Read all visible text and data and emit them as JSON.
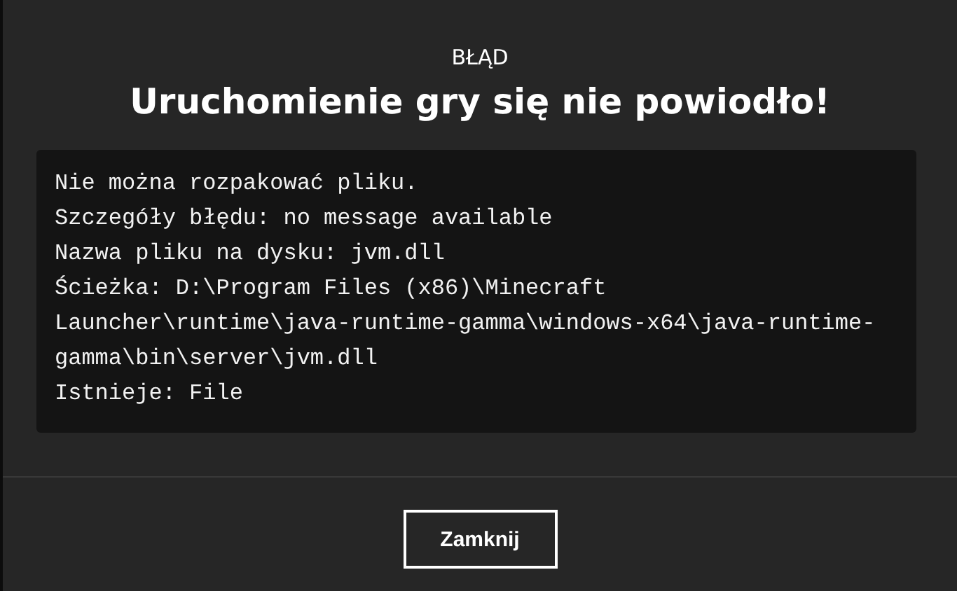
{
  "dialog": {
    "label": "BŁĄD",
    "title": "Uruchomienie gry się nie powiodło!",
    "details": [
      "Nie można rozpakować pliku.",
      "Szczegóły błędu: no message available",
      "Nazwa pliku na dysku: jvm.dll",
      "Ścieżka: D:\\Program Files (x86)\\Minecraft Launcher\\runtime\\java-runtime-gamma\\windows-x64\\java-runtime-gamma\\bin\\server\\jvm.dll",
      "Istnieje: File"
    ],
    "buttons": [
      "Zamknij"
    ]
  }
}
